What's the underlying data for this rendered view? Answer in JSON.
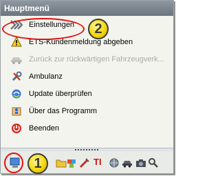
{
  "header": {
    "title": "Hauptmenü"
  },
  "menu": {
    "items": [
      {
        "label": "Einstellungen",
        "icon": "settings-chevrons-icon",
        "enabled": true
      },
      {
        "label": "ETS-Kundenmeldung abgeben",
        "icon": "warning-icon",
        "enabled": true
      },
      {
        "label": "Zurück zur rückwärtigen Fahrzeugverk...",
        "icon": "car-back-icon",
        "enabled": false
      },
      {
        "label": "Ambulanz",
        "icon": "tools-icon",
        "enabled": true
      },
      {
        "label": "Update überprüfen",
        "icon": "update-icon",
        "enabled": true
      },
      {
        "label": "Über das Programm",
        "icon": "info-icon",
        "enabled": true
      },
      {
        "label": "Beenden",
        "icon": "power-icon",
        "enabled": true
      }
    ]
  },
  "annotations": {
    "badge_1": "1",
    "badge_2": "2"
  },
  "toolbar": {
    "ti_label": "TI"
  },
  "colors": {
    "highlight_ring": "#e01010",
    "badge_fill": "#f5d90a",
    "header_bg": "#7b848c"
  }
}
